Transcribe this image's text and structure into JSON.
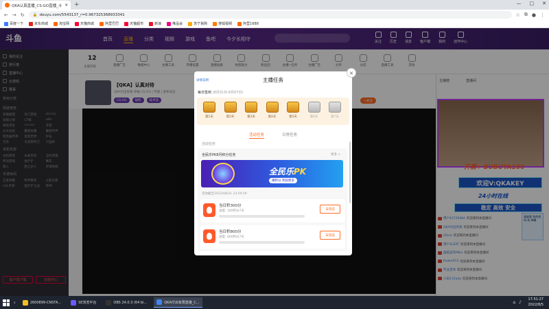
{
  "browser": {
    "tab_title": "QKA认真直播_CS:GO直播_斗...",
    "new_tab": "+",
    "url": "douyu.com/5543137_r=0.967325368933341",
    "window_controls": [
      "—",
      "□",
      "✕"
    ],
    "bookmarks": [
      "百度一下",
      "京东商城",
      "淘宝网",
      "天猫商城",
      "阿里巴巴",
      "天猫超市",
      "新浪",
      "唯品会",
      "苏宁易购",
      "搜狐视频",
      "阿里1688"
    ]
  },
  "site": {
    "logo": "斗鱼",
    "nav": [
      "首页",
      "直播",
      "分类",
      "视频",
      "游戏",
      "鱼吧",
      "今夕长相守"
    ],
    "header_icons": [
      "关注",
      "历史",
      "消息",
      "客户端",
      "我的",
      "创作中心"
    ]
  },
  "sidebar": {
    "top_items": [
      "我的关注",
      "排行榜",
      "直播中心",
      "云游戏",
      "赛事"
    ],
    "groups": [
      {
        "title": "常用分类",
        "items": []
      },
      {
        "title": "网游竞技",
        "items": [
          "英雄联盟",
          "热门游戏",
          "DOTA2",
          "穿越火线",
          "CF端",
          "DNF",
          "绝地求生",
          "CS:GO",
          "守望",
          "从众竞技",
          "魔兽争霸",
          "魔兽世界",
          "暗黑破坏神",
          "坦克世界",
          "炉石",
          "方舟",
          "天涯明月刀",
          "三国杀"
        ]
      },
      {
        "title": "单机热游",
        "items": [
          "主机游戏",
          "永劫无间",
          "全民英雄",
          "怀旧游戏",
          "金铲铲",
          "赛车",
          "猎人",
          "网上达人",
          "环球地图"
        ]
      },
      {
        "title": "手游休闲",
        "items": [
          "王者荣耀",
          "和平精英",
          "火影忍者",
          "LOL手游",
          "金铲铲之战",
          "原神"
        ]
      }
    ],
    "buttons": [
      "客户端下载",
      "充值中心"
    ]
  },
  "stats": {
    "level": "12",
    "level_label": "主播等级",
    "items": [
      "直播广告",
      "数据中心",
      "主播工具",
      "开播设置",
      "直播准备",
      "抗疫助力",
      "粉丝团",
      "主播~任务",
      "主播广告",
      "分享",
      "分成",
      "直播工具",
      "其他"
    ]
  },
  "room": {
    "title": "【QKA】认真对待",
    "meta": "QKA付出有限  举报  CS:GO  |  专题  |  发布动态",
    "tags": [
      "CS:GO",
      "福利",
      "技术流"
    ],
    "follow_btn": "+关注",
    "right_tabs": [
      "主播榜",
      "直播间"
    ]
  },
  "overlays": {
    "o1": "开黑+ BUBUYA166",
    "o2": "欢迎V:QKAKEY",
    "o3": "24小时在线",
    "o4": "稳定 高效 安全"
  },
  "chat": [
    {
      "user": "用户43729484",
      "msg": "欢迎来到本直播间"
    },
    {
      "user": "QKA付出有限",
      "msg": "欢迎来到本直播间"
    },
    {
      "user": "Olivia",
      "msg": "欢迎来到本直播间"
    },
    {
      "user": "用户ALERT",
      "msg": "欢迎来到本直播间"
    },
    {
      "user": "超级菜鸟Mike",
      "msg": "欢迎来到本直播间"
    },
    {
      "user": "Kuwor813",
      "msg": "欢迎来到本直播间"
    },
    {
      "user": "专业咨询",
      "msg": "欢迎来到本直播间"
    },
    {
      "user": "小白112adu",
      "msg": "欢迎来到本直播间"
    }
  ],
  "promo": "请留意 你的房间 有 弹幕",
  "modal": {
    "title": "主播任务",
    "rules_link": "详情说明",
    "close": "×",
    "checkin_label": "每日签到",
    "checkin_period": "(8月01日-8月07日)",
    "days": [
      {
        "label": "第1天",
        "done": true
      },
      {
        "label": "第2天",
        "done": true
      },
      {
        "label": "第3天",
        "done": true
      },
      {
        "label": "第4天",
        "done": true
      },
      {
        "label": "第5天",
        "done": true
      },
      {
        "label": "第6天",
        "done": false
      },
      {
        "label": "第7天",
        "done": false
      }
    ],
    "tabs": [
      "活动任务",
      "日常任务"
    ],
    "section_label": "活动任务",
    "activity_title": "全民乐PK8月积分任务",
    "activity_more": "更多 >",
    "banner_main": "全民乐",
    "banner_pk": "PK",
    "banner_sub": "赚积分 奖励更多",
    "activity_time": "活动截至2022/08/31 23:59:59",
    "tasks": [
      {
        "title": "当日积300分",
        "progress": "进度: 300积分7天",
        "button": "未完成"
      },
      {
        "title": "当日积800分",
        "progress": "进度: 800积分7天",
        "button": "未完成"
      }
    ]
  },
  "taskbar": {
    "apps": [
      "2600899-CNSTA...",
      "SE浏览平台",
      "OBS 24.0.3 (64 bi...",
      "QKA付出有限直播_C..."
    ],
    "time": "17:51:27",
    "date": "2022/8/5"
  }
}
